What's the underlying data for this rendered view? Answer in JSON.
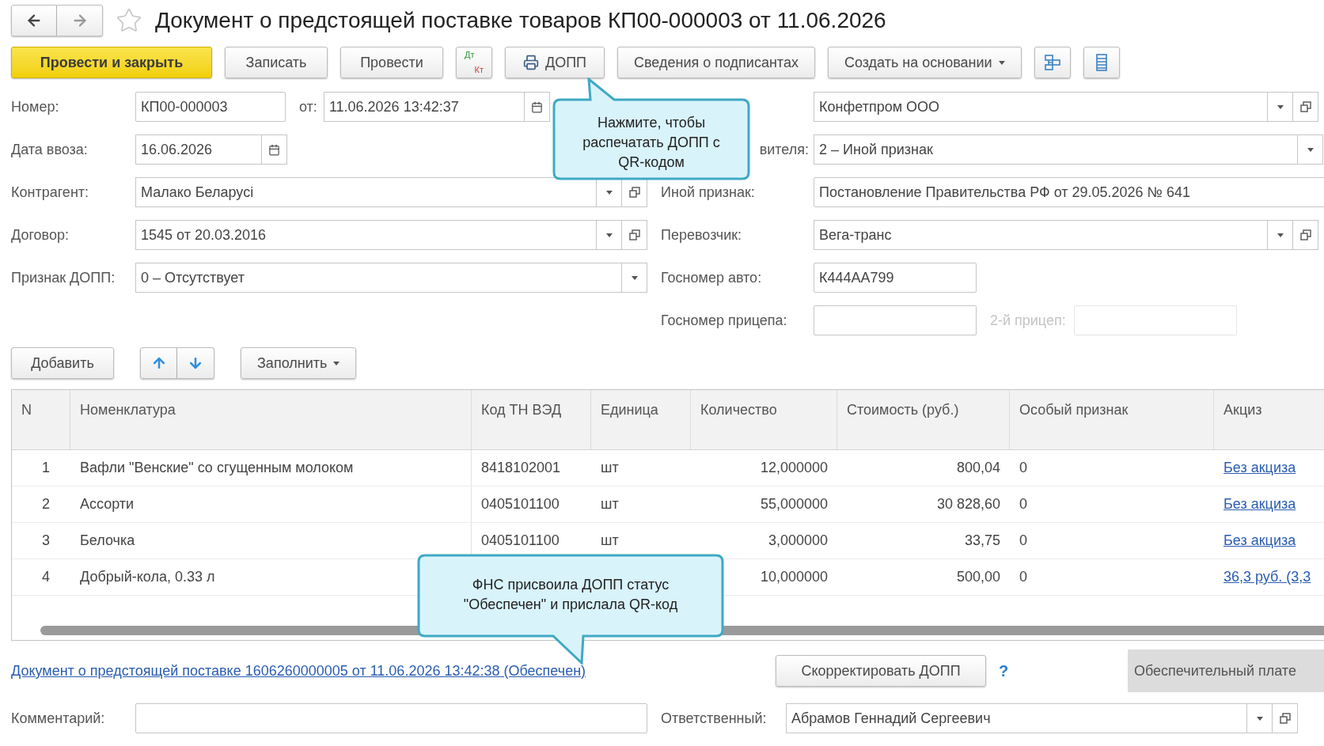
{
  "title": "Документ о предстоящей поставке товаров КП00-000003 от 11.06.2026",
  "toolbar": [
    {
      "kind": "primary",
      "label": "Провести и закрыть"
    },
    {
      "kind": "default",
      "label": "Записать"
    },
    {
      "kind": "default",
      "label": "Провести"
    },
    {
      "kind": "dtkt",
      "label_top": "Дт",
      "label_bottom": "Кт"
    },
    {
      "kind": "print",
      "label": "ДОПП"
    },
    {
      "kind": "default",
      "label": "Сведения о подписантах"
    },
    {
      "kind": "menu",
      "label": "Создать на основании"
    },
    {
      "kind": "structure"
    },
    {
      "kind": "list"
    }
  ],
  "form_left": [
    {
      "label": "Номер:",
      "fields": [
        {
          "kind": "text",
          "value": "КП00-000003"
        },
        {
          "kind": "date",
          "label": "от:",
          "value": "11.06.2026 13:42:37"
        }
      ]
    },
    {
      "label": "Дата ввоза:",
      "fields": [
        {
          "kind": "date",
          "value": "16.06.2026"
        }
      ]
    },
    {
      "label": "Контрагент:",
      "fields": [
        {
          "kind": "select-open",
          "value": "Малако Беларусi"
        }
      ]
    },
    {
      "label": "Договор:",
      "fields": [
        {
          "kind": "select-open",
          "value": "1545 от 20.03.2016"
        }
      ]
    },
    {
      "label": "Признак ДОПП:",
      "fields": [
        {
          "kind": "select",
          "value": "0 – Отсутствует"
        }
      ]
    }
  ],
  "form_right": [
    {
      "fields": [
        {
          "kind": "select-open",
          "value": "Конфетпром ООО"
        }
      ]
    },
    {
      "label": "вителя:",
      "fields": [
        {
          "kind": "select",
          "value": "2 – Иной признак"
        }
      ]
    },
    {
      "label": "Иной признак:",
      "fields": [
        {
          "kind": "text",
          "value": "Постановление Правительства РФ от 29.05.2026 № 641"
        }
      ]
    },
    {
      "label": "Перевозчик:",
      "fields": [
        {
          "kind": "select-open",
          "value": "Вега-транс"
        }
      ]
    },
    {
      "label": "Госномер авто:",
      "fields": [
        {
          "kind": "text",
          "value": "К444АА799"
        }
      ]
    },
    {
      "label": "Госномер прицепа:",
      "fields": [
        {
          "kind": "text"
        },
        {
          "kind": "disabled",
          "label": "2-й прицеп:"
        }
      ]
    }
  ],
  "table_toolbar": [
    {
      "kind": "default",
      "label": "Добавить"
    },
    {
      "kind": "arrows"
    },
    {
      "kind": "menu",
      "label": "Заполнить"
    }
  ],
  "table": {
    "columns": [
      "N",
      "Номенклатура",
      "Код ТН ВЭД",
      "Единица",
      "Количество",
      "Стоимость (руб.)",
      "Особый признак",
      "Акциз"
    ],
    "rows": [
      {
        "n": "1",
        "name": "Вафли \"Венские\" со сгущенным молоком",
        "code": "8418102001",
        "unit": "шт",
        "qty": "12,000000",
        "cost": "800,04",
        "special": "0",
        "excise": "Без акциза"
      },
      {
        "n": "2",
        "name": "Ассорти",
        "code": "0405101100",
        "unit": "шт",
        "qty": "55,000000",
        "cost": "30 828,60",
        "special": "0",
        "excise": "Без акциза"
      },
      {
        "n": "3",
        "name": "Белочка",
        "code": "0405101100",
        "unit": "шт",
        "qty": "3,000000",
        "cost": "33,75",
        "special": "0",
        "excise": "Без акциза"
      },
      {
        "n": "4",
        "name": "Добрый-кола, 0.33 л",
        "qty": "10,000000",
        "cost": "500,00",
        "special": "0",
        "excise": "36,3 руб. (3,3"
      }
    ]
  },
  "callouts": [
    {
      "text": "Нажмите, чтобы распечатать ДОПП с QR-кодом"
    },
    {
      "text": "ФНС присвоила ДОПП статус \"Обеспечен\" и прислала QR-код"
    }
  ],
  "doc_link": "Документ о предстоящей поставке 1606260000005 от 11.06.2026 13:42:38 (Обеспечен)",
  "correct_button": "Скорректировать ДОПП",
  "help": "?",
  "payment_button": "Обеспечительный плате",
  "comment": {
    "label": "Комментарий:"
  },
  "responsible": {
    "label": "Ответственный:",
    "kind": "select-open",
    "value": "Абрамов Геннадий Сергеевич"
  }
}
